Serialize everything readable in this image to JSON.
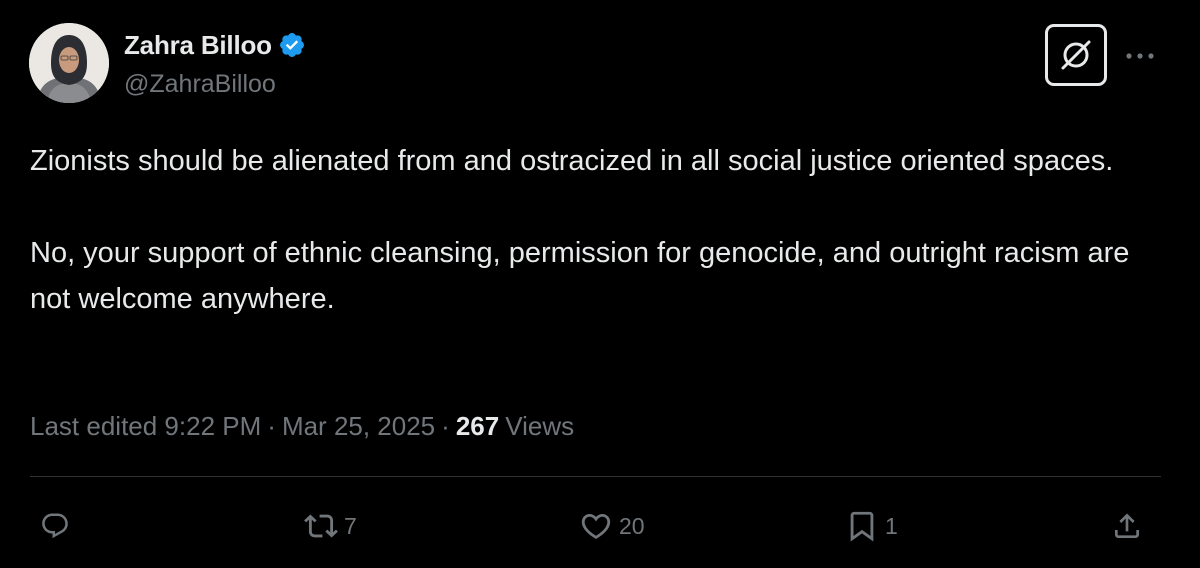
{
  "tweet": {
    "author": {
      "display_name": "Zahra Billoo",
      "handle": "@ZahraBilloo",
      "verified": true,
      "verified_color": "#1d9bf0"
    },
    "text_paragraphs": [
      "Zionists should be alienated from and ostracized in all social justice oriented spaces.",
      "No, your support of ethnic cleansing, permission for genocide, and outright racism are not welcome anywhere."
    ],
    "meta": {
      "edited_label": "Last edited 9:22 PM",
      "separator": "·",
      "date": "Mar 25, 2025",
      "views_count": "267",
      "views_label": "Views"
    },
    "actions": {
      "retweet_count": "7",
      "like_count": "20",
      "bookmark_count": "1"
    },
    "icons": {
      "grok": "grok-icon",
      "more": "more-horizontal-icon",
      "reply": "reply-icon",
      "retweet": "retweet-icon",
      "like": "heart-icon",
      "bookmark": "bookmark-icon",
      "share": "share-icon"
    }
  },
  "theme": {
    "background": "#000000",
    "text_primary": "#e7e9ea",
    "text_secondary": "#71767b",
    "divider": "#2f3336"
  }
}
